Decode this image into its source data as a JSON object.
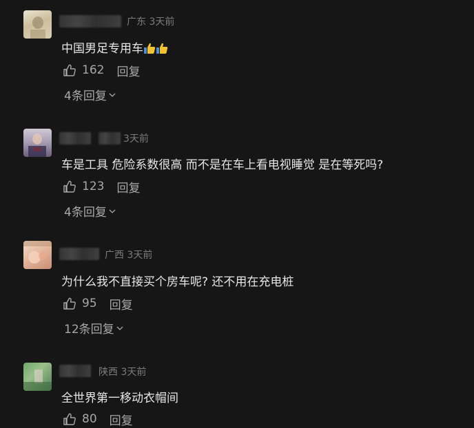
{
  "comments": [
    {
      "location": "广东",
      "time": "3天前",
      "text": "中国男足专用车",
      "emoji": "thumbs-up-icon",
      "likes": "162",
      "reply_label": "回复",
      "replies": "4条回复"
    },
    {
      "location": "",
      "time": "3天前",
      "text": "车是工具 危险系数很高 而不是在车上看电视睡觉 是在等死吗?",
      "likes": "123",
      "reply_label": "回复",
      "replies": "4条回复"
    },
    {
      "location": "广西",
      "time": "3天前",
      "text": "为什么我不直接买个房车呢? 还不用在充电桩",
      "likes": "95",
      "reply_label": "回复",
      "replies": "12条回复"
    },
    {
      "location": "陕西",
      "time": "3天前",
      "text": "全世界第一移动衣帽间",
      "likes": "80",
      "reply_label": "回复"
    }
  ],
  "colors": {
    "background": "#161616",
    "text": "#e6e6e6",
    "muted": "#7c7c7c",
    "action": "#a8a8a8",
    "thumb_emoji": "#f2c230"
  }
}
